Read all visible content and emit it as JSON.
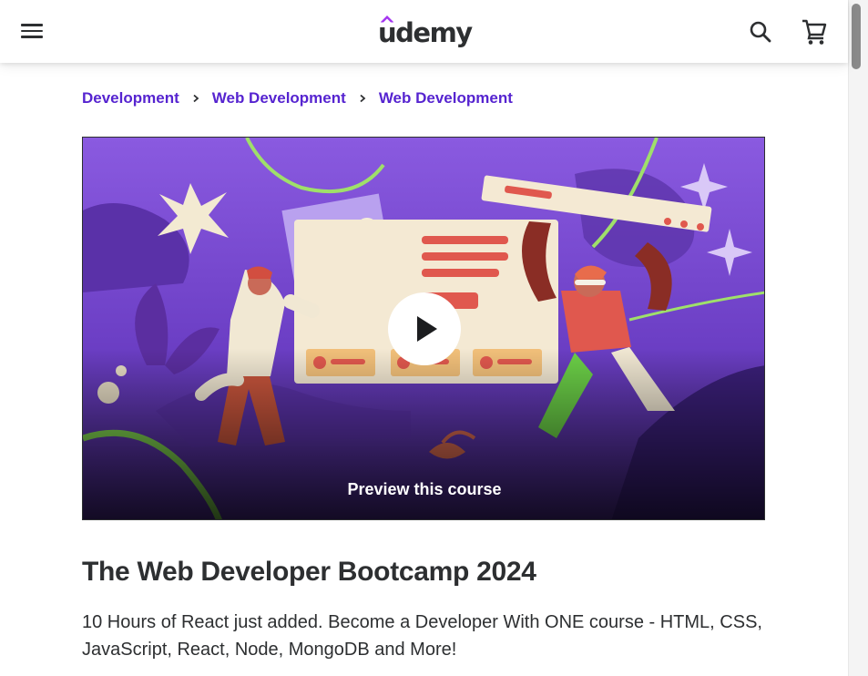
{
  "header": {
    "logo_text": "udemy",
    "menu_icon": "hamburger-menu-icon",
    "search_icon": "search-icon",
    "cart_icon": "shopping-cart-icon",
    "accent": "#a435f0"
  },
  "breadcrumb": {
    "items": [
      {
        "label": "Development"
      },
      {
        "label": "Web Development"
      },
      {
        "label": "Web Development"
      }
    ],
    "color": "#5624d0"
  },
  "preview": {
    "label": "Preview this course",
    "play_icon": "play-icon"
  },
  "course": {
    "title": "The Web Developer Bootcamp 2024",
    "description": "10 Hours of React just added. Become a Developer With ONE course - HTML, CSS, JavaScript, React, Node, MongoDB and More!"
  }
}
